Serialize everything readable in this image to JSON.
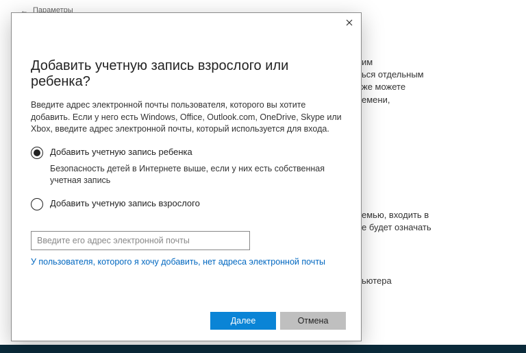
{
  "bg": {
    "params_label": "Параметры",
    "line1": "им",
    "line2": "ься отдельным",
    "line3": "же можете",
    "line4": "емени,",
    "line5": "емью, входить в",
    "line6": "е будет означать",
    "line7": "ьютера"
  },
  "modal": {
    "title": "Добавить учетную запись взрослого или ребенка?",
    "desc": "Введите адрес электронной почты пользователя, которого вы хотите добавить. Если у него есть Windows, Office, Outlook.com, OneDrive, Skype или Xbox, введите адрес электронной почты, который используется для входа.",
    "options": {
      "child_label": "Добавить учетную запись ребенка",
      "child_help": "Безопасность детей в Интернете выше, если у них есть собственная учетная запись",
      "adult_label": "Добавить учетную запись взрослого"
    },
    "email_placeholder": "Введите его адрес электронной почты",
    "no_email_link": "У пользователя, которого я хочу добавить, нет адреса электронной почты",
    "buttons": {
      "next": "Далее",
      "cancel": "Отмена"
    }
  }
}
